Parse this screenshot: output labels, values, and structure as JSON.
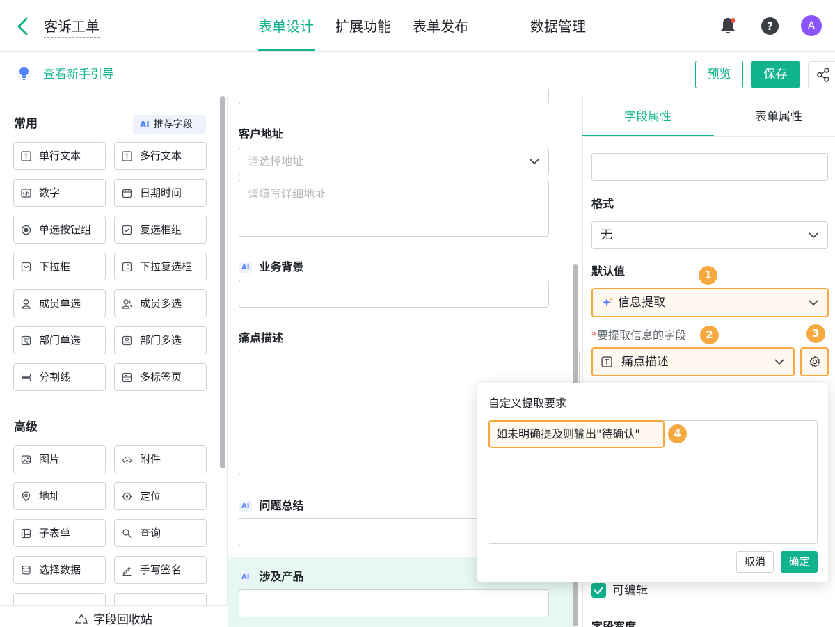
{
  "app": {
    "title": "客诉工单"
  },
  "nav": {
    "tabs": [
      "表单设计",
      "扩展功能",
      "表单发布",
      "数据管理"
    ],
    "active": 0,
    "avatar_letter": "A"
  },
  "toolbar": {
    "guide_link": "查看新手引导",
    "preview": "预览",
    "save": "保存"
  },
  "left_panel": {
    "common_title": "常用",
    "ai_badge": "AI",
    "ai_recommend": "推荐字段",
    "common_fields": [
      "单行文本",
      "多行文本",
      "数字",
      "日期时间",
      "单选按钮组",
      "复选框组",
      "下拉框",
      "下拉复选框",
      "成员单选",
      "成员多选",
      "部门单选",
      "部门多选",
      "分割线",
      "多标签页"
    ],
    "advanced_title": "高级",
    "advanced_fields": [
      "图片",
      "附件",
      "地址",
      "定位",
      "子表单",
      "查询",
      "选择数据",
      "手写签名"
    ],
    "recycle_bin": "字段回收站"
  },
  "canvas": {
    "ai_tag": "AI",
    "address_label": "客户地址",
    "address_select_placeholder": "请选择地址",
    "address_detail_placeholder": "请填写详细地址",
    "background_label": "业务背景",
    "pain_label": "痛点描述",
    "summary_label": "问题总结",
    "product_label": "涉及产品"
  },
  "right_panel": {
    "tabs": [
      "字段属性",
      "表单属性"
    ],
    "format_label": "格式",
    "format_value": "无",
    "default_label": "默认值",
    "default_value": "信息提取",
    "extract_required": "*",
    "extract_label": "要提取信息的字段",
    "extract_value": "痛点描述",
    "editable_label": "可编辑",
    "width_label": "字段宽度"
  },
  "badges": [
    "1",
    "2",
    "3",
    "4"
  ],
  "popup": {
    "title": "自定义提取要求",
    "text": "如未明确提及则输出\"待确认\"",
    "cancel": "取消",
    "ok": "确定"
  },
  "colors": {
    "accent": "#10b38e",
    "highlight": "#f7a941",
    "ai_blue": "#4e83fd"
  }
}
